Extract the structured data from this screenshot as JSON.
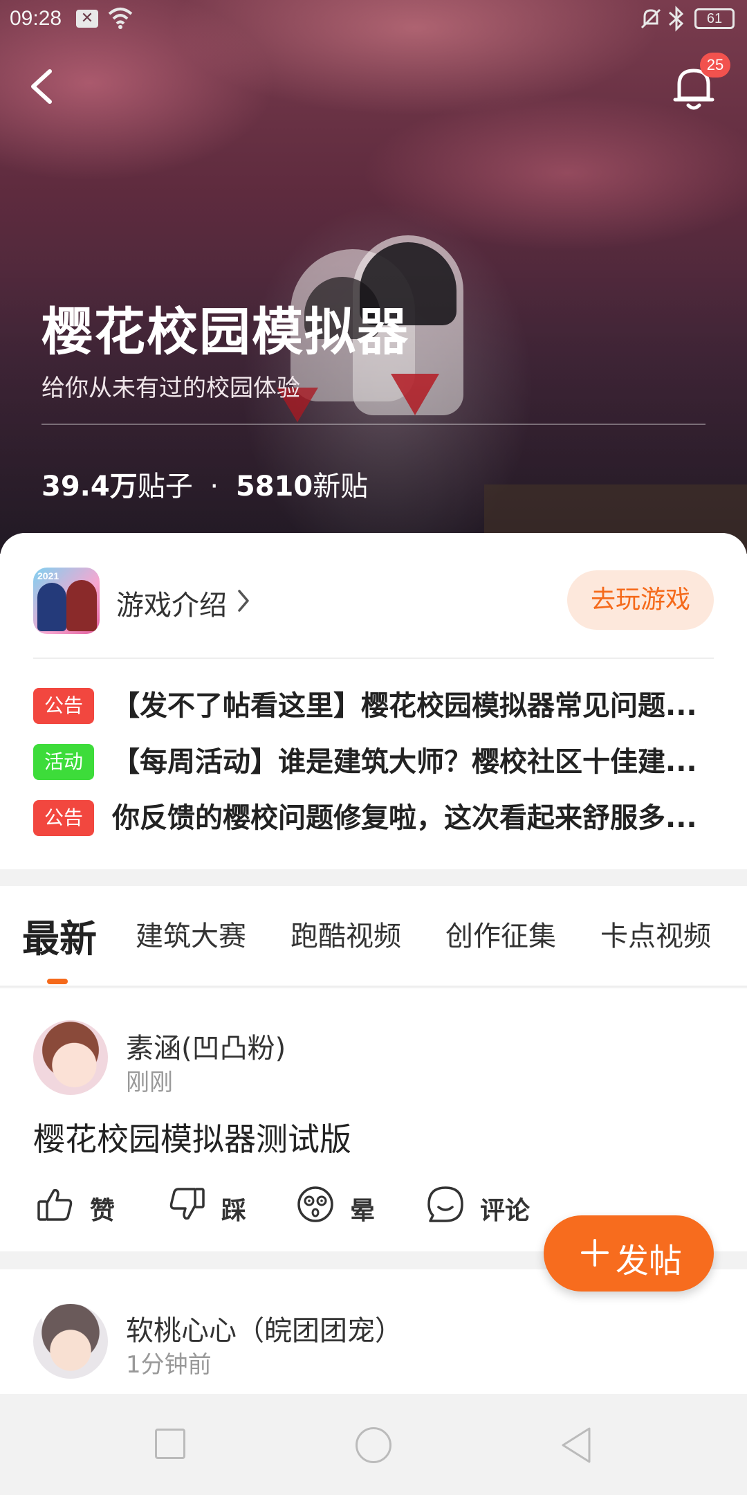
{
  "status_bar": {
    "time": "09:28",
    "battery": "61"
  },
  "header": {
    "notification_count": "25"
  },
  "hero": {
    "title": "樱花校园模拟器",
    "subtitle": "给你从未有过的校园体验",
    "posts_count": "39.4万",
    "posts_label": "贴子",
    "separator": "·",
    "new_count": "5810",
    "new_label": "新贴"
  },
  "game": {
    "icon_tag": "2021",
    "intro_label": "游戏介绍",
    "play_label": "去玩游戏"
  },
  "notices": [
    {
      "tag": "公告",
      "tag_color": "#f2473f",
      "text": "【发不了帖看这里】樱花校园模拟器常见问题..."
    },
    {
      "tag": "活动",
      "tag_color": "#3ddc3a",
      "text": "【每周活动】谁是建筑大师？樱校社区十佳建..."
    },
    {
      "tag": "公告",
      "tag_color": "#f2473f",
      "text": "你反馈的樱校问题修复啦，这次看起来舒服多..."
    }
  ],
  "tabs": [
    {
      "label": "最新",
      "active": true
    },
    {
      "label": "建筑大赛"
    },
    {
      "label": "跑酷视频"
    },
    {
      "label": "创作征集"
    },
    {
      "label": "卡点视频"
    }
  ],
  "posts": [
    {
      "username": "素涵(凹凸粉)",
      "time": "刚刚",
      "content": "樱花校园模拟器测试版",
      "actions": {
        "like": "赞",
        "dislike": "踩",
        "dizzy": "晕",
        "comment": "评论"
      }
    },
    {
      "username": "软桃心心（皖团团宠）",
      "time": "1分钟前"
    }
  ],
  "fab": {
    "label": "发帖"
  },
  "colors": {
    "accent": "#f76c1e",
    "badge": "#f2524e"
  }
}
